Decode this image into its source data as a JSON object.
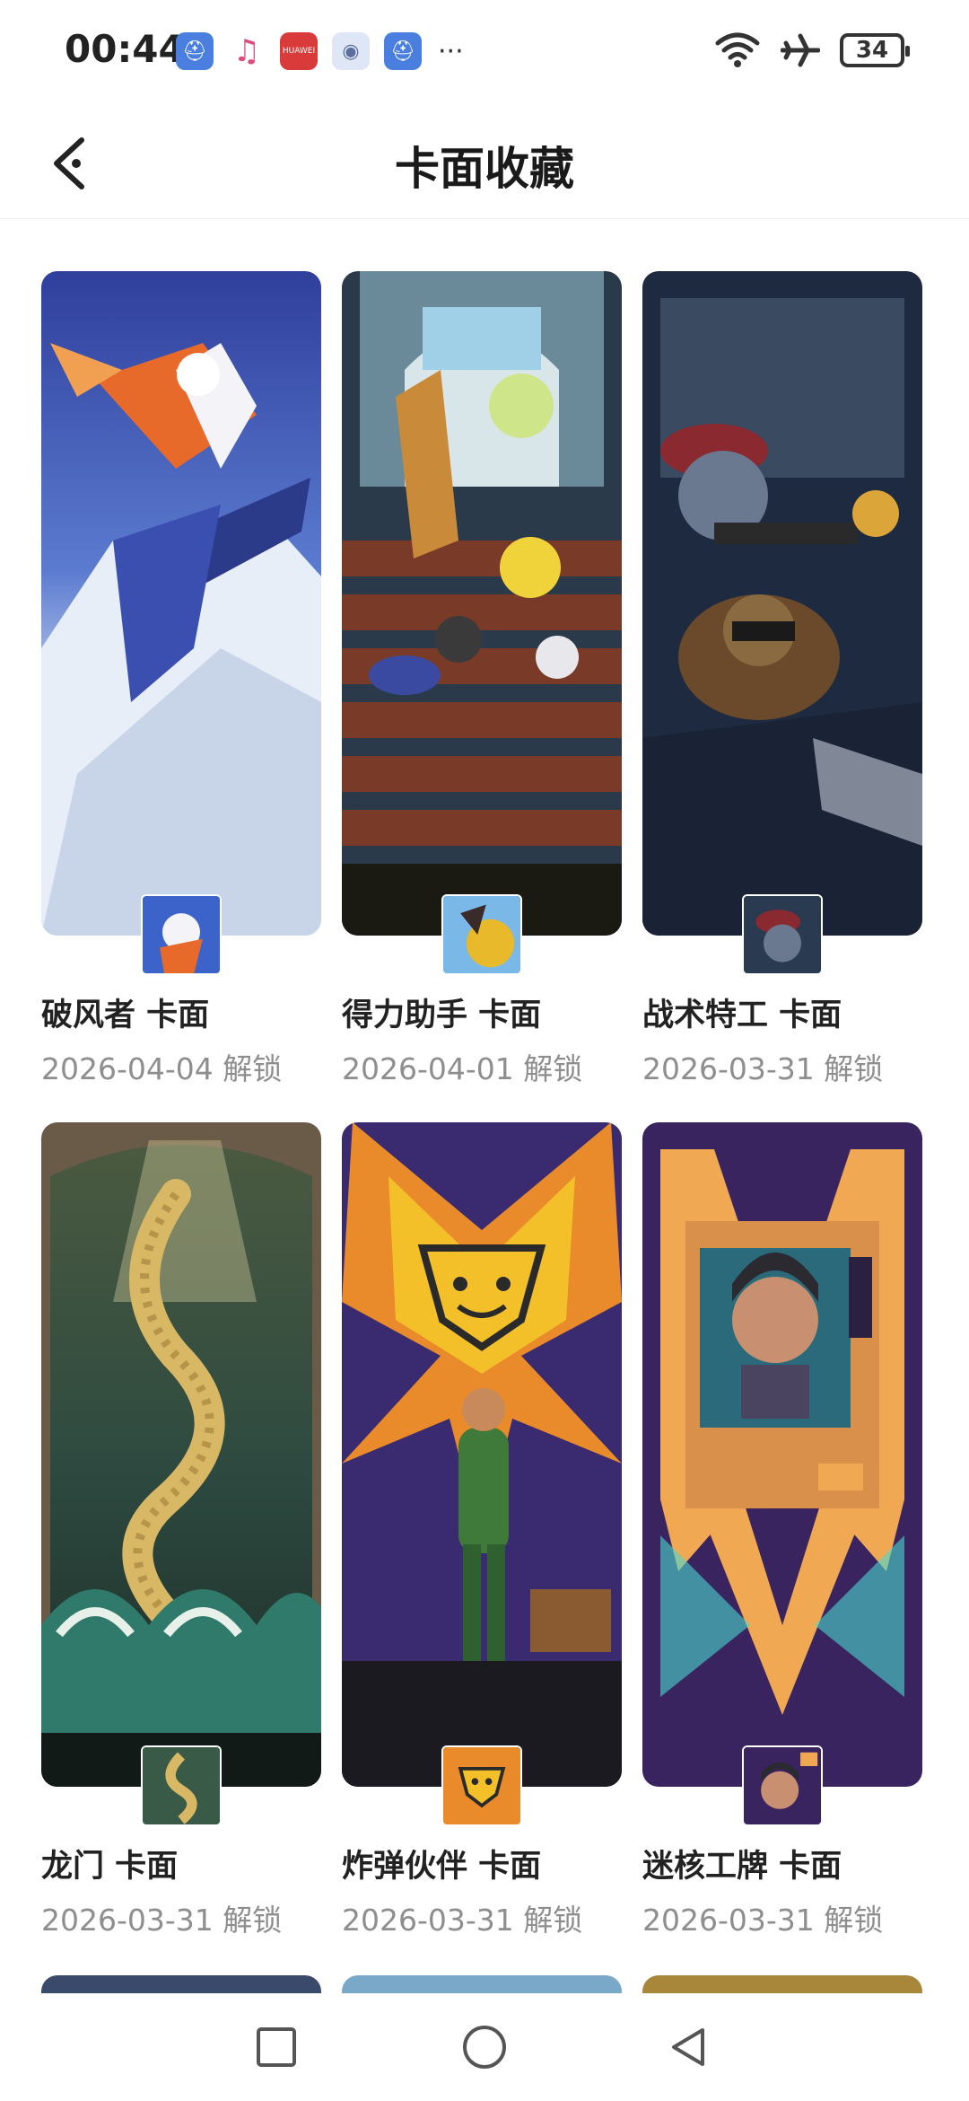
{
  "status_bar": {
    "time": "00:44",
    "battery": "34",
    "icons": [
      "wifi-icon",
      "airplane-icon",
      "battery-icon"
    ],
    "app_icons": [
      "shield-app-icon",
      "music-app-icon",
      "huawei-app-icon",
      "robot-app-icon",
      "shield-app-icon"
    ],
    "huawei_label": "HUAWEI",
    "more": "···"
  },
  "header": {
    "title": "卡面收藏"
  },
  "cards": [
    {
      "title": "破风者 卡面",
      "date": "2026-04-04 解锁",
      "accent": "#3c63c9"
    },
    {
      "title": "得力助手 卡面",
      "date": "2026-04-01 解锁",
      "accent": "#e7b92b"
    },
    {
      "title": "战术特工 卡面",
      "date": "2026-03-31 解锁",
      "accent": "#2a3a5a"
    },
    {
      "title": "龙门 卡面",
      "date": "2026-03-31 解锁",
      "accent": "#2f5a4a"
    },
    {
      "title": "炸弹伙伴 卡面",
      "date": "2026-03-31 解锁",
      "accent": "#e98a2b"
    },
    {
      "title": "迷核工牌 卡面",
      "date": "2026-03-31 解锁",
      "accent": "#3a2460"
    }
  ],
  "nav": {
    "icons": [
      "recent-apps-icon",
      "home-icon",
      "back-icon"
    ]
  }
}
